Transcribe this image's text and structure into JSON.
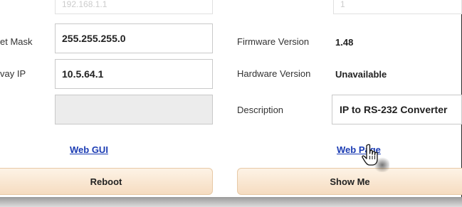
{
  "left": {
    "top_field_value": "192.168.1.1",
    "subnet_label": "et Mask",
    "subnet_value": "255.255.255.0",
    "gateway_label": "vay IP",
    "gateway_value": "10.5.64.1",
    "blank_field_value": "",
    "web_gui_link": "Web GUI",
    "reboot_button": "Reboot"
  },
  "right": {
    "top_field_value": "1",
    "firmware_label": "Firmware Version",
    "firmware_value": "1.48",
    "hardware_label": "Hardware Version",
    "hardware_value": "Unavailable",
    "description_label": "Description",
    "description_value": "IP to RS-232 Converter",
    "web_page_link": "Web Page",
    "show_me_button": "Show Me"
  },
  "icons": {
    "cursor": "hand-pointer-icon"
  }
}
